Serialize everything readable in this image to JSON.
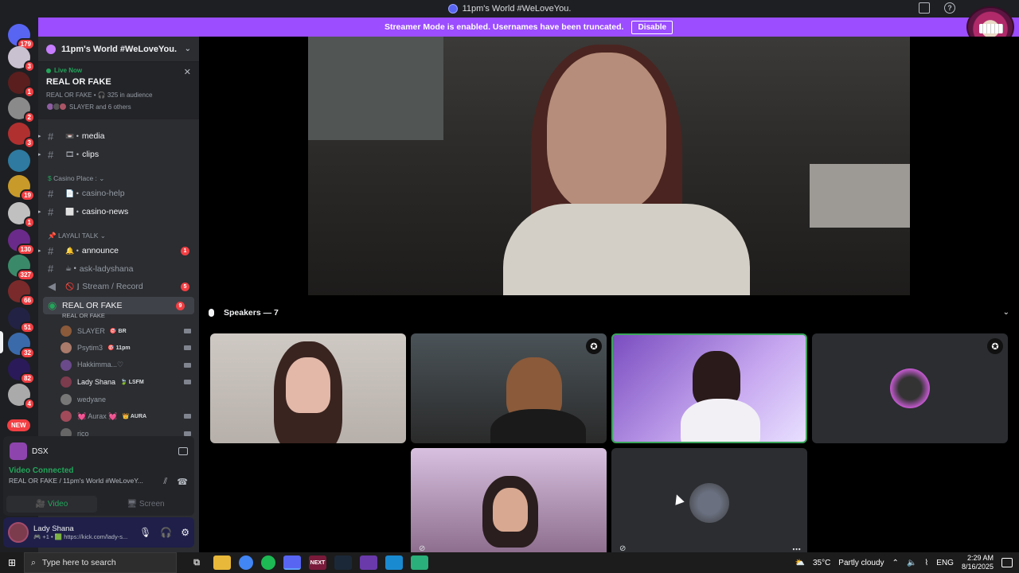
{
  "window": {
    "title": "11pm's World #WeLoveYou."
  },
  "banner": {
    "text": "Streamer Mode is enabled. Usernames have been truncated.",
    "button": "Disable"
  },
  "rail": {
    "servers": [
      {
        "badge": "179",
        "color": "#5865f2"
      },
      {
        "badge": "3",
        "color": "#c9c0d0"
      },
      {
        "badge": "1",
        "color": "#5a1e1e"
      },
      {
        "badge": "2",
        "color": "#8a8a8a"
      },
      {
        "badge": "3",
        "color": "#b03030"
      },
      {
        "badge": "",
        "color": "#2e7aa0"
      },
      {
        "badge": "19",
        "color": "#c89a2a"
      },
      {
        "badge": "1",
        "color": "#c0c0c0"
      },
      {
        "badge": "130",
        "color": "#6a2a8a"
      },
      {
        "badge": "327",
        "color": "#3a8a6a"
      },
      {
        "badge": "66",
        "color": "#7a2a2a"
      },
      {
        "badge": "51",
        "color": "#222244"
      },
      {
        "badge": "32",
        "color": "#3a6aaa"
      },
      {
        "badge": "82",
        "color": "#2a1a5a"
      },
      {
        "badge": "4",
        "color": "#aaaaaa"
      }
    ],
    "new_label": "NEW"
  },
  "sidebar": {
    "server_name": "11pm's World #WeLoveYou.",
    "live": {
      "status": "Live Now",
      "title": "REAL OR FAKE",
      "sub": "REAL OR FAKE • 🎧 325 in audience",
      "avatars_text": "SLAYER and 6 others"
    },
    "channels": [
      {
        "name": "media",
        "emoji": "📼 •",
        "unread": true,
        "badge": ""
      },
      {
        "name": "clips",
        "emoji": "🎞 •",
        "unread": true,
        "badge": ""
      }
    ],
    "cat_casino": "Casino Place :",
    "casino_channels": [
      {
        "name": "casino-help",
        "emoji": "📄 •",
        "unread": false,
        "badge": ""
      },
      {
        "name": "casino-news",
        "emoji": "⬜ •",
        "unread": true,
        "badge": ""
      }
    ],
    "cat_layali": "LAYALI TALK",
    "layali_channels": [
      {
        "name": "announce",
        "emoji": "🔔 •",
        "unread": true,
        "badge": "1"
      },
      {
        "name": "ask-ladyshana",
        "emoji": "☕ •",
        "unread": false,
        "badge": ""
      },
      {
        "name": "Stream / Record",
        "emoji": "🚫 ⌋",
        "unread": false,
        "badge": "5"
      }
    ],
    "voice_channel": {
      "name": "REAL OR FAKE",
      "sub": "REAL OR FAKE",
      "badge": "9"
    },
    "voice_users": [
      {
        "name": "SLAYER",
        "tag": "🎯 BR"
      },
      {
        "name": "Psytim3",
        "tag": "🎯 11pm"
      },
      {
        "name": "Hakkimma...♡",
        "tag": ""
      },
      {
        "name": "Lady Shana",
        "tag": "🍃 LSFM"
      },
      {
        "name": "wedyane",
        "tag": ""
      },
      {
        "name": "💓 Aurax 💓",
        "tag": "👑 AURA"
      },
      {
        "name": "rico",
        "tag": ""
      }
    ]
  },
  "voice_panel": {
    "server": "DSX",
    "status": "Video Connected",
    "path": "REAL OR FAKE / 11pm's World #WeLoveY...",
    "video_label": "Video",
    "screen_label": "Screen"
  },
  "user_panel": {
    "name": "Lady Shana",
    "status": "🎮 +1 • 🟩 https://kick.com/lady-s..."
  },
  "stage": {
    "speakers_label": "Speakers — 7"
  },
  "taskbar": {
    "search_placeholder": "Type here to search",
    "weather_temp": "35°C",
    "weather_text": "Partly cloudy",
    "lang": "ENG",
    "time": "2:29 AM",
    "date": "8/16/2025"
  }
}
